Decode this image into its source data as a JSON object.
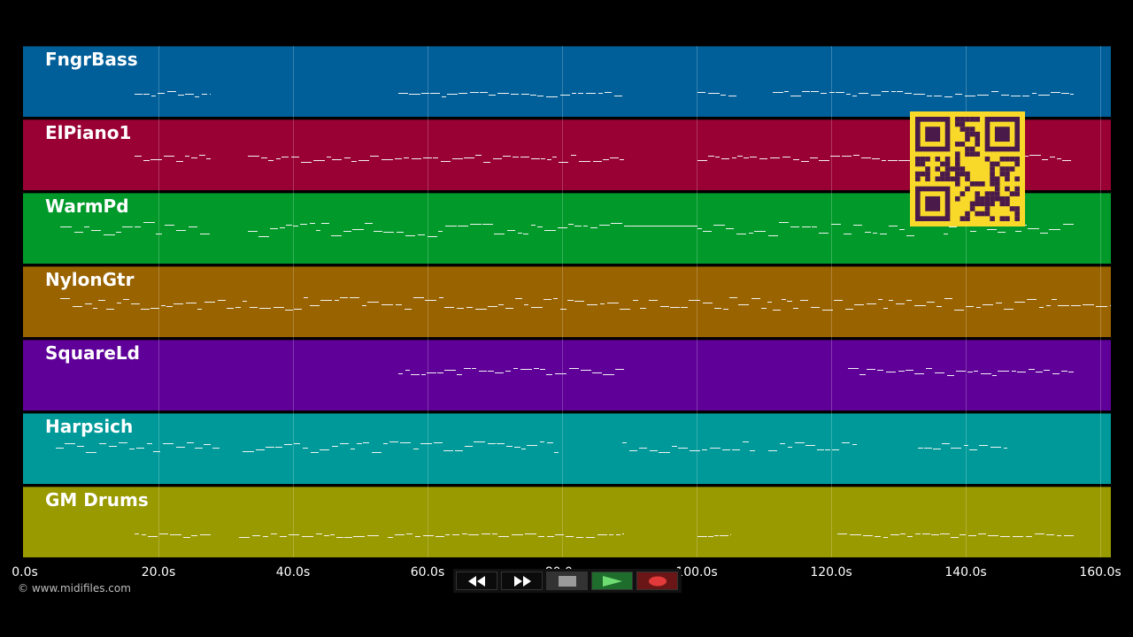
{
  "tracks": [
    {
      "name": "FngrBass",
      "color": "#005f99"
    },
    {
      "name": "ElPiano1",
      "color": "#990033"
    },
    {
      "name": "WarmPd",
      "color": "#00992a"
    },
    {
      "name": "NylonGtr",
      "color": "#996300"
    },
    {
      "name": "SquareLd",
      "color": "#5f0099"
    },
    {
      "name": "Harpsich",
      "color": "#009999"
    },
    {
      "name": "GM Drums",
      "color": "#999900"
    }
  ],
  "timeline": {
    "ticks": [
      "0.0s",
      "20.0s",
      "40.0s",
      "60.0s",
      "80.0s",
      "100.0s",
      "120.0s",
      "140.0s",
      "160.0s"
    ]
  },
  "footer": {
    "copyright": "© www.midifiles.com"
  },
  "transport": {
    "buttons": [
      {
        "name": "rewind-button",
        "icon": "rewind-icon"
      },
      {
        "name": "fast-forward-button",
        "icon": "fast-forward-icon"
      },
      {
        "name": "stop-button",
        "icon": "stop-icon"
      },
      {
        "name": "play-button",
        "icon": "play-icon"
      },
      {
        "name": "record-button",
        "icon": "record-icon"
      }
    ]
  },
  "overlay": {
    "icon": "qr-code-icon",
    "color": "#f8d92a",
    "ink": "#4a1a4a"
  }
}
